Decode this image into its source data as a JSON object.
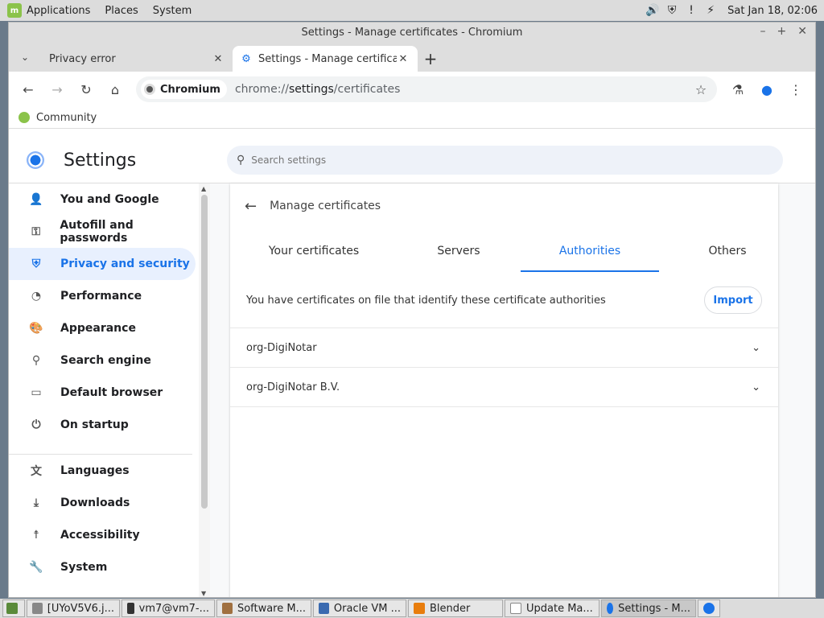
{
  "panel": {
    "applications": "Applications",
    "places": "Places",
    "system": "System",
    "clock": "Sat Jan 18, 02:06"
  },
  "window": {
    "title": "Settings - Manage certificates - Chromium",
    "tabs": [
      {
        "title": "Privacy error"
      },
      {
        "title": "Settings - Manage certificates"
      }
    ],
    "omnibox": {
      "chip": "Chromium",
      "url_scheme": "chrome://",
      "url_host": "settings",
      "url_path": "/certificates"
    },
    "bookmarks": [
      {
        "label": "Community"
      }
    ]
  },
  "settings": {
    "title": "Settings",
    "search_placeholder": "Search settings",
    "nav": [
      {
        "label": "You and Google",
        "icon": "person-icon"
      },
      {
        "label": "Autofill and passwords",
        "icon": "key-icon"
      },
      {
        "label": "Privacy and security",
        "icon": "shield-icon"
      },
      {
        "label": "Performance",
        "icon": "speedometer-icon"
      },
      {
        "label": "Appearance",
        "icon": "palette-icon"
      },
      {
        "label": "Search engine",
        "icon": "search-icon"
      },
      {
        "label": "Default browser",
        "icon": "browser-icon"
      },
      {
        "label": "On startup",
        "icon": "power-icon"
      },
      {
        "label": "Languages",
        "icon": "translate-icon"
      },
      {
        "label": "Downloads",
        "icon": "download-icon"
      },
      {
        "label": "Accessibility",
        "icon": "accessibility-icon"
      },
      {
        "label": "System",
        "icon": "wrench-icon"
      }
    ],
    "page_title": "Manage certificates",
    "cert_tabs": [
      "Your certificates",
      "Servers",
      "Authorities",
      "Others"
    ],
    "active_tab": "Authorities",
    "description": "You have certificates on file that identify these certificate authorities",
    "import_label": "Import",
    "certificates": [
      "org-DigiNotar",
      "org-DigiNotar B.V."
    ]
  },
  "taskbar": [
    {
      "label": "[UYoV5V6.j..."
    },
    {
      "label": "vm7@vm7-..."
    },
    {
      "label": "Software M..."
    },
    {
      "label": "Oracle VM ..."
    },
    {
      "label": "Blender"
    },
    {
      "label": "Update Ma..."
    },
    {
      "label": "Settings - M..."
    }
  ],
  "colors": {
    "accent": "#1a73e8",
    "selected_nav_bg": "#e8f0fe"
  }
}
